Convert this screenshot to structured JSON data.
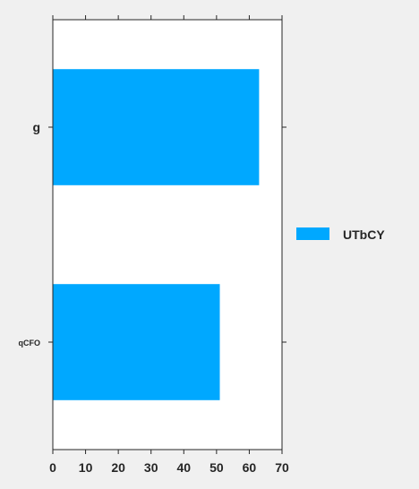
{
  "chart_data": {
    "type": "bar",
    "orientation": "horizontal",
    "categories": [
      "g",
      "qCFO"
    ],
    "series": [
      {
        "name": "UTbCY",
        "values": [
          63,
          51
        ],
        "color": "#00a8ff"
      }
    ],
    "xlim": [
      0,
      70
    ],
    "xticks": [
      0,
      10,
      20,
      30,
      40,
      50,
      60,
      70
    ],
    "title": "",
    "xlabel": "",
    "ylabel": "",
    "grid": false,
    "legend": {
      "placement": "right"
    }
  }
}
